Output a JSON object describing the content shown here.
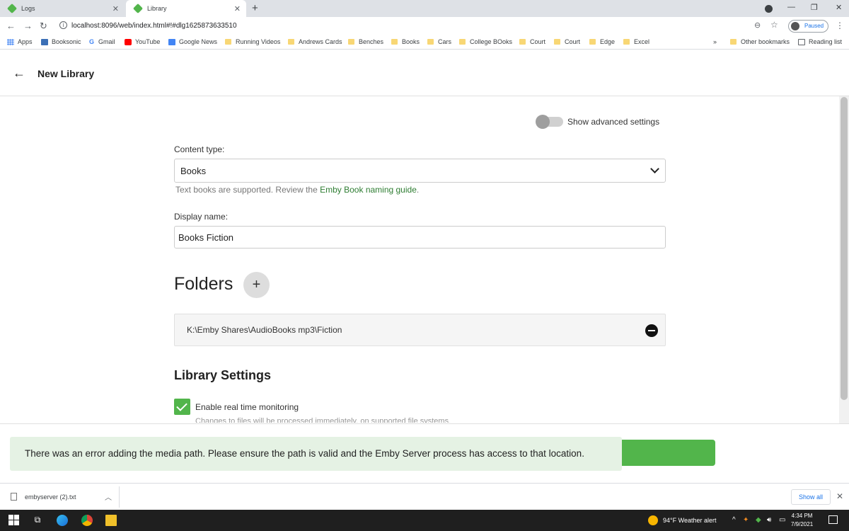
{
  "browser": {
    "tabs": [
      {
        "title": "Logs"
      },
      {
        "title": "Library"
      }
    ],
    "new_tab": "+",
    "url": "localhost:8096/web/index.html#!#dlg1625873633510",
    "profile_status": "Paused",
    "bookmarks": [
      "Apps",
      "Booksonic",
      "Gmail",
      "YouTube",
      "Google News",
      "Running Videos",
      "Andrews Cards",
      "Benches",
      "Books",
      "Cars",
      "College BOoks",
      "Court",
      "Court",
      "Edge",
      "Excel"
    ],
    "bookmarks_overflow": "»",
    "other_bookmarks": "Other bookmarks",
    "reading_list": "Reading list"
  },
  "header": {
    "title": "New Library"
  },
  "form": {
    "advanced_toggle_label": "Show advanced settings",
    "advanced_toggle_on": false,
    "content_type_label": "Content type:",
    "content_type_value": "Books",
    "content_type_help": "Text books are supported. Review the ",
    "content_type_help_link": "Emby Book naming guide",
    "content_type_help_end": ".",
    "display_name_label": "Display name:",
    "display_name_value": "Books Fiction"
  },
  "folders": {
    "heading": "Folders",
    "add_label": "+",
    "items": [
      "K:\\Emby Shares\\AudioBooks mp3\\Fiction"
    ]
  },
  "library_settings": {
    "heading": "Library Settings",
    "realtime_label": "Enable real time monitoring",
    "realtime_checked": true,
    "realtime_desc": "Changes to files will be processed immediately, on supported file systems."
  },
  "toast": {
    "message": "There was an error adding the media path. Please ensure the path is valid and the Emby Server process has access to that location."
  },
  "downloads": {
    "file": "embyserver (2).txt",
    "show_all": "Show all"
  },
  "taskbar": {
    "weather": "94°F  Weather alert",
    "time": "4:34 PM",
    "date": "7/9/2021"
  },
  "colors": {
    "accent": "#52b54b",
    "link": "#2e7d32",
    "toast_bg": "#e5f2e4"
  }
}
